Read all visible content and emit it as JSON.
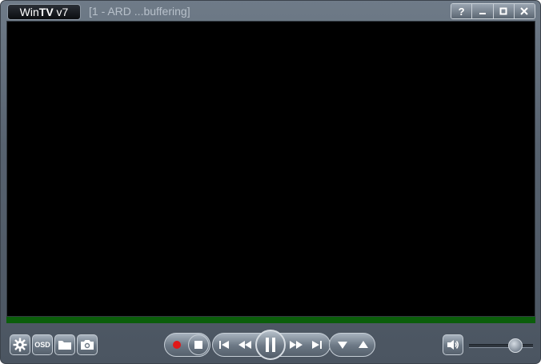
{
  "app": {
    "logo_prefix": "Win",
    "logo_bold": "TV",
    "logo_suffix": " v7",
    "title": "[1 - ARD ...buffering]"
  },
  "window_controls": {
    "help": "?",
    "minimize": "–",
    "maximize": "□",
    "close": "✕"
  },
  "toolbar": {
    "osd_label": "OSD"
  },
  "volume": {
    "level": 0.72
  },
  "colors": {
    "status_green": "#0b5e0b",
    "record_red": "#e01818"
  }
}
